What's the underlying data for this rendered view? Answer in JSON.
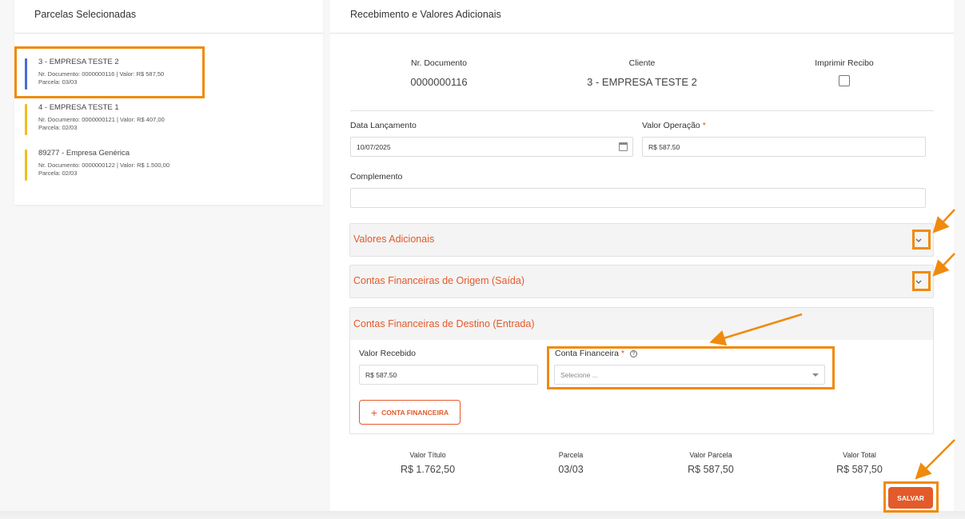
{
  "left_panel": {
    "title": "Parcelas Selecionadas",
    "items": [
      {
        "title": "3 - EMPRESA TESTE 2",
        "doc_line": "Nr. Documento: 0000000116 | Valor: R$ 587,50",
        "parcela_line": "Parcela: 03/03",
        "color": "#4a6cd4"
      },
      {
        "title": "4 - EMPRESA TESTE 1",
        "doc_line": "Nr. Documento: 0000000121 | Valor: R$ 407,00",
        "parcela_line": "Parcela: 02/03",
        "color": "#f2be1e"
      },
      {
        "title": "89277 - Empresa Genérica",
        "doc_line": "Nr. Documento: 0000000122 | Valor: R$ 1.500,00",
        "parcela_line": "Parcela: 02/03",
        "color": "#f2be1e"
      }
    ]
  },
  "main": {
    "title": "Recebimento e Valores Adicionais",
    "info": {
      "doc_label": "Nr. Documento",
      "doc_value": "0000000116",
      "client_label": "Cliente",
      "client_value": "3 - EMPRESA TESTE 2",
      "print_label": "Imprimir Recibo"
    },
    "form": {
      "date_label": "Data Lançamento",
      "date_value": "10/07/2025",
      "valor_label": "Valor Operação",
      "valor_value": "R$ 587.50",
      "required_mark": "*",
      "complemento_label": "Complemento",
      "complemento_value": ""
    },
    "accordions": {
      "valores_adicionais": "Valores Adicionais",
      "origem": "Contas Financeiras de Origem (Saída)",
      "destino": "Contas Financeiras de Destino (Entrada)"
    },
    "destino": {
      "valor_recebido_label": "Valor Recebido",
      "valor_recebido_value": "R$ 587.50",
      "conta_label": "Conta Financeira",
      "conta_placeholder": "Selecione ...",
      "add_button": "CONTA FINANCEIRA",
      "help_glyph": "?"
    },
    "summary": [
      {
        "label": "Valor Título",
        "value": "R$ 1.762,50"
      },
      {
        "label": "Parcela",
        "value": "03/03"
      },
      {
        "label": "Valor Parcela",
        "value": "R$ 587,50"
      },
      {
        "label": "Valor Total",
        "value": "R$ 587,50"
      }
    ],
    "save_button": "SALVAR"
  },
  "colors": {
    "accent": "#e35a2b",
    "highlight": "#f08a0c"
  }
}
